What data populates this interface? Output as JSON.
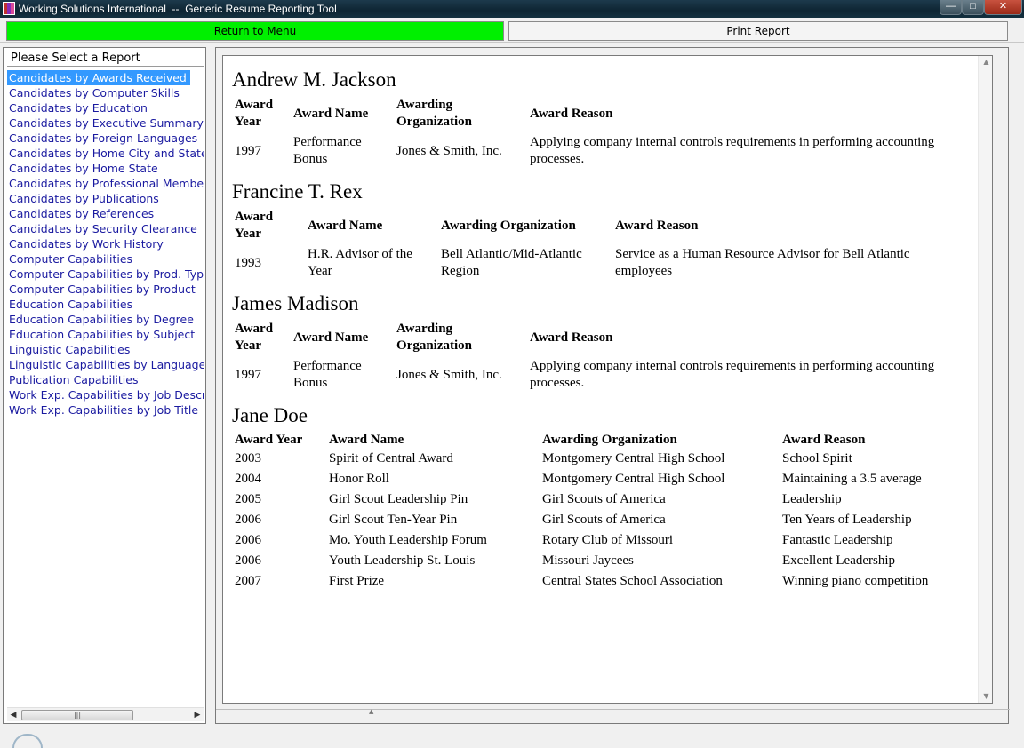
{
  "window": {
    "title": "Working Solutions International  --  Generic Resume Reporting Tool",
    "min_glyph": "—",
    "max_glyph": "□",
    "close_glyph": "✕"
  },
  "toolbar": {
    "menu_label": "Return to Menu",
    "print_label": "Print Report",
    "menu_color": "#00f000"
  },
  "sidebar": {
    "header": "Please Select a Report",
    "selected_index": 0,
    "items": [
      "Candidates by Awards Received",
      "Candidates by Computer Skills",
      "Candidates by Education",
      "Candidates by Executive Summary",
      "Candidates by Foreign Languages",
      "Candidates by Home City and State",
      "Candidates by Home State",
      "Candidates by Professional Membership",
      "Candidates by Publications",
      "Candidates by References",
      "Candidates by Security Clearance",
      "Candidates by Work History",
      "Computer Capabilities",
      "Computer Capabilities by Prod. Type",
      "Computer Capabilities by Product",
      "Education Capabilities",
      "Education Capabilities by Degree",
      "Education Capabilities by Subject",
      "Linguistic Capabilities",
      "Linguistic Capabilities by Language",
      "Publication Capabilities",
      "Work Exp. Capabilities by Job Description",
      "Work Exp. Capabilities by Job Title"
    ],
    "scroll_left": "◀",
    "scroll_right": "▶",
    "scroll_grip": "|||"
  },
  "scroll": {
    "up": "▲",
    "down": "▼",
    "grip": "▲"
  },
  "report": {
    "candidates": [
      {
        "name": "Andrew M. Jackson",
        "headers": [
          "Award Year",
          "Award Name",
          "Awarding Organization",
          "Award Reason"
        ],
        "rows": [
          [
            "1997",
            "Performance Bonus",
            "Jones & Smith, Inc.",
            "Applying company internal controls requirements in performing accounting processes."
          ]
        ]
      },
      {
        "name": "Francine T. Rex",
        "headers": [
          "Award Year",
          "Award Name",
          "Awarding Organization",
          "Award Reason"
        ],
        "rows": [
          [
            "1993",
            "H.R. Advisor of the Year",
            "Bell Atlantic/Mid-Atlantic Region",
            "Service as a Human Resource Advisor for Bell Atlantic employees"
          ]
        ]
      },
      {
        "name": "James Madison",
        "headers": [
          "Award Year",
          "Award Name",
          "Awarding Organization",
          "Award Reason"
        ],
        "rows": [
          [
            "1997",
            "Performance Bonus",
            "Jones & Smith, Inc.",
            "Applying company internal controls requirements in performing accounting processes."
          ]
        ]
      },
      {
        "name": "Jane Doe",
        "headers": [
          "Award Year",
          "Award Name",
          "Awarding Organization",
          "Award Reason"
        ],
        "rows": [
          [
            "2003",
            "Spirit of Central Award",
            "Montgomery Central High School",
            "School Spirit"
          ],
          [
            "2004",
            "Honor Roll",
            "Montgomery Central High School",
            "Maintaining a 3.5 average"
          ],
          [
            "2005",
            "Girl Scout Leadership Pin",
            "Girl Scouts of America",
            "Leadership"
          ],
          [
            "2006",
            "Girl Scout Ten-Year Pin",
            "Girl Scouts of America",
            "Ten Years of Leadership"
          ],
          [
            "2006",
            "Mo. Youth Leadership Forum",
            "Rotary Club of Missouri",
            "Fantastic Leadership"
          ],
          [
            "2006",
            "Youth Leadership St. Louis",
            "Missouri Jaycees",
            "Excellent Leadership"
          ],
          [
            "2007",
            "First Prize",
            "Central States School Association",
            "Winning piano competition"
          ]
        ]
      }
    ]
  }
}
